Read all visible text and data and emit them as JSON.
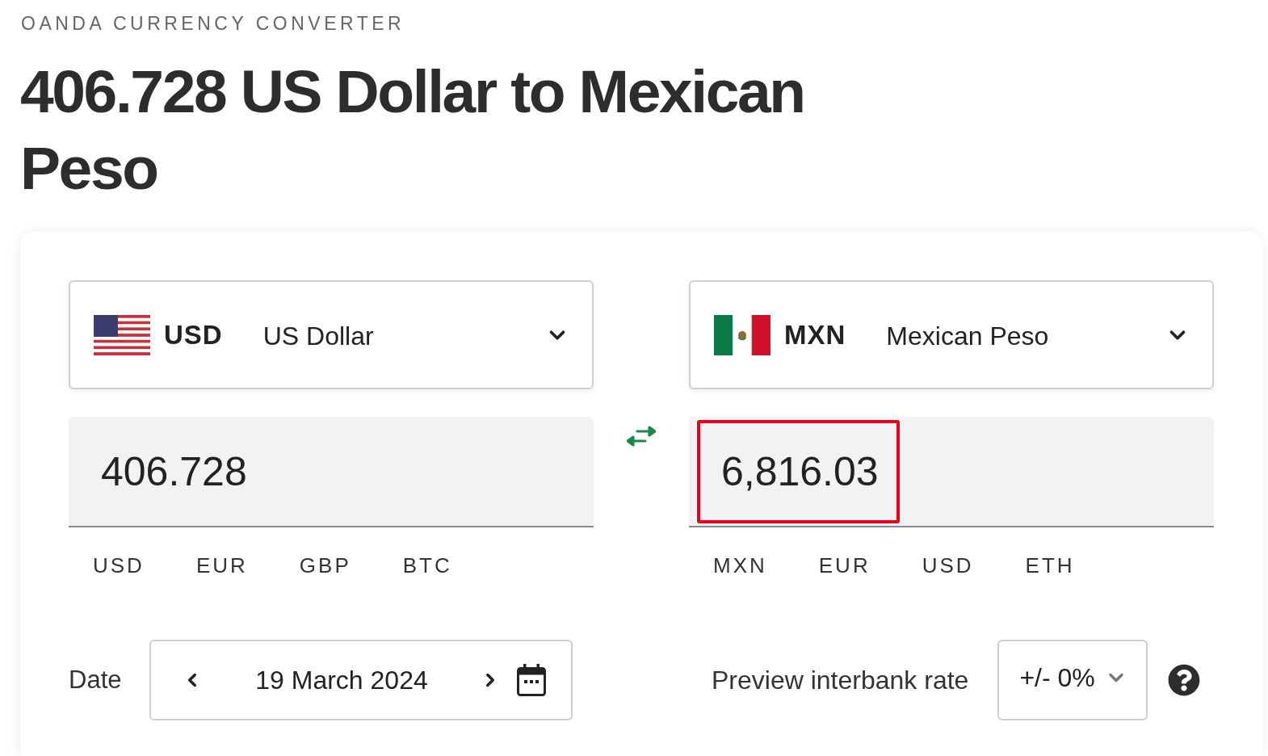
{
  "header": {
    "brand": "OANDA CURRENCY CONVERTER",
    "title": "406.728 US Dollar to Mexican Peso"
  },
  "converter": {
    "panels": [
      {
        "code": "USD",
        "name": "US Dollar",
        "amount": "406.728",
        "highlighted": false,
        "quick_currencies": [
          "USD",
          "EUR",
          "GBP",
          "BTC"
        ]
      },
      {
        "code": "MXN",
        "name": "Mexican Peso",
        "amount": "6,816.03",
        "highlighted": true,
        "quick_currencies": [
          "MXN",
          "EUR",
          "USD",
          "ETH"
        ]
      }
    ]
  },
  "date_picker": {
    "label": "Date",
    "value": "19 March 2024"
  },
  "interbank_rate": {
    "label": "Preview interbank rate",
    "value": "+/- 0%"
  }
}
